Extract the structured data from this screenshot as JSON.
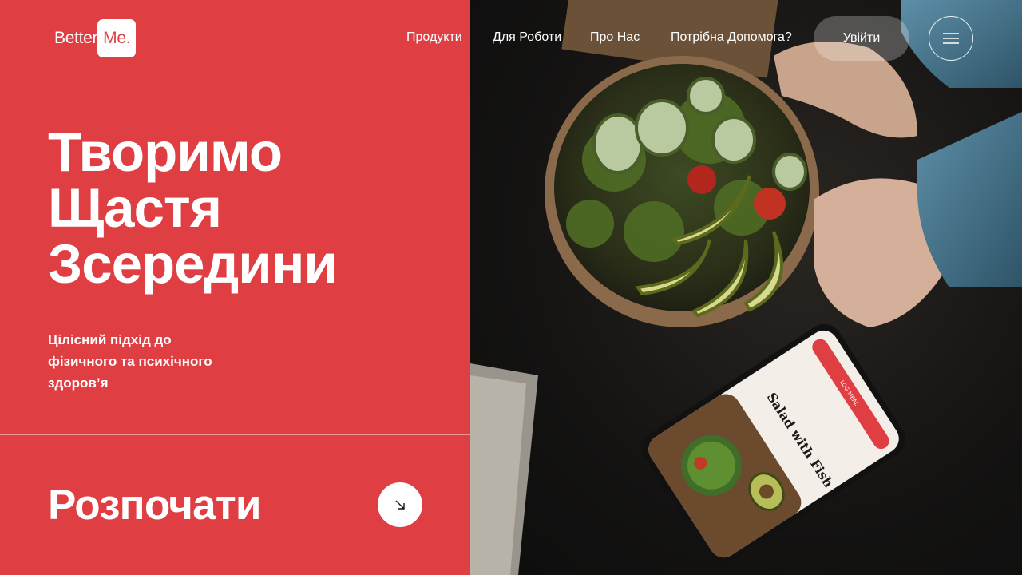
{
  "brand": {
    "name_part1": "Better",
    "name_part2": "Me."
  },
  "nav": {
    "links": [
      "Продукти",
      "Для Роботи",
      "Про Нас",
      "Потрібна Допомога?"
    ],
    "login_label": "Увійти"
  },
  "hero": {
    "title_lines": [
      "Творимо",
      "Щастя",
      "Зсередини"
    ],
    "subtitle": "Цілісний підхід до фізичного та психічного здоров’я"
  },
  "cta": {
    "label": "Розпочати"
  },
  "phone_app": {
    "dish_title": "Salad with Fish",
    "button_label": "LOG MEAL"
  },
  "colors": {
    "accent": "#df3f43",
    "text_light": "#ffffff"
  },
  "icons": {
    "menu": "hamburger-menu-icon",
    "cta_arrow": "arrow-down-right-icon"
  }
}
